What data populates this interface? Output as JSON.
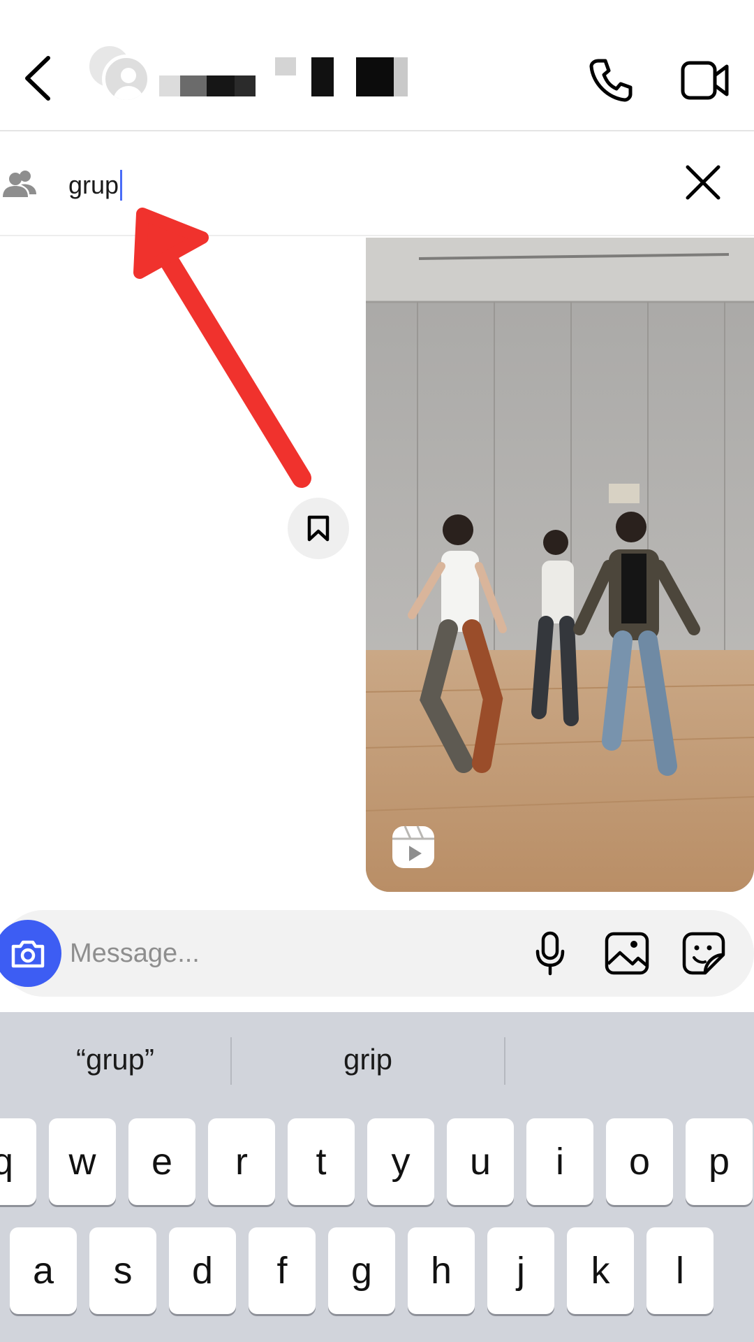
{
  "header": {
    "back_icon": "chevron-left-icon",
    "call_icon": "phone-icon",
    "video_icon": "video-camera-icon"
  },
  "group_bar": {
    "icon": "group-icon",
    "value": "grup",
    "close_icon": "close-icon"
  },
  "chat": {
    "save_icon": "bookmark-icon",
    "reel_icon": "reels-icon"
  },
  "composer": {
    "placeholder": "Message...",
    "camera_icon": "camera-icon",
    "mic_icon": "microphone-icon",
    "gallery_icon": "image-icon",
    "sticker_icon": "sticker-icon",
    "accent": "#3d5df3"
  },
  "keyboard": {
    "suggestions": [
      "“grup”",
      "grip",
      ""
    ],
    "row1": [
      "q",
      "w",
      "e",
      "r",
      "t",
      "y",
      "u",
      "i",
      "o",
      "p"
    ],
    "row2": [
      "a",
      "s",
      "d",
      "f",
      "g",
      "h",
      "j",
      "k",
      "l"
    ]
  },
  "annotation": {
    "arrow_color": "#f0322d"
  }
}
